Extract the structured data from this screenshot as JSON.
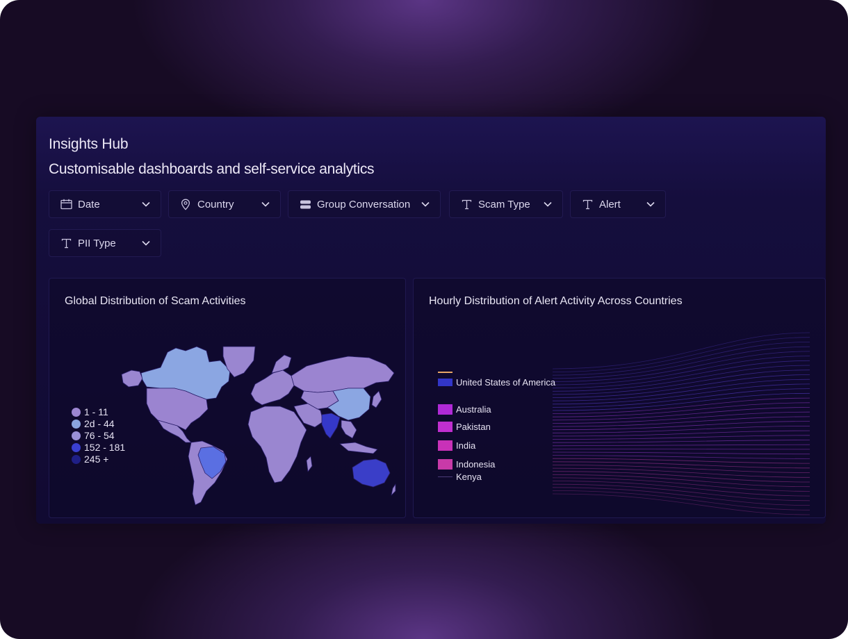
{
  "header": {
    "title": "Insights Hub",
    "subtitle": "Customisable dashboards and self-service analytics"
  },
  "filters": [
    {
      "label": "Date",
      "icon": "calendar-icon"
    },
    {
      "label": "Country",
      "icon": "location-pin-icon"
    },
    {
      "label": "Group Conversation",
      "icon": "group-icon"
    },
    {
      "label": "Scam Type",
      "icon": "text-type-icon"
    },
    {
      "label": "Alert",
      "icon": "text-type-icon"
    },
    {
      "label": "PII Type",
      "icon": "text-type-icon"
    }
  ],
  "map_card": {
    "title": "Global Distribution of Scam Activities",
    "legend": [
      {
        "label": "1 - 11",
        "color": "#9d86d2"
      },
      {
        "label": "2d - 44",
        "color": "#8aa4e0"
      },
      {
        "label": "76 - 54",
        "color": "#9a90d8"
      },
      {
        "label": "152 - 181",
        "color": "#3a3fd0"
      },
      {
        "label": "245 +",
        "color": "#1f1f86"
      }
    ]
  },
  "hourly_card": {
    "title": "Hourly Distribution of Alert Activity Across Countries",
    "legend": [
      {
        "label": "United States of America",
        "color": "#3236c8",
        "line": "#e8a765"
      },
      {
        "label": "Australia",
        "color": "#b02ad6"
      },
      {
        "label": "Pakistan",
        "color": "#c02fcf"
      },
      {
        "label": "India",
        "color": "#c931b8"
      },
      {
        "label": "Indonesia",
        "color": "#c83aa8"
      },
      {
        "label": "Kenya",
        "color": "#4a3c78"
      }
    ]
  },
  "colors": {
    "background": "#170b24",
    "panel": "#150e3d",
    "accent": "#5b3585"
  }
}
